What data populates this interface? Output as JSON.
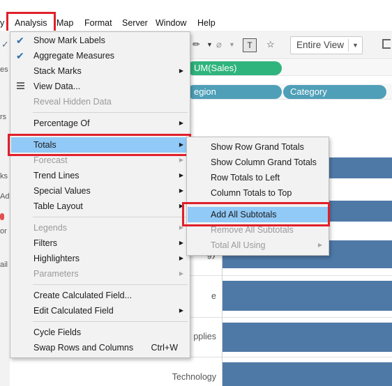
{
  "menubar": {
    "partial_left": "y",
    "items": [
      "Analysis",
      "Map",
      "Format",
      "Server",
      "Window",
      "Help"
    ]
  },
  "toolbar": {
    "fit_label": "Entire View"
  },
  "shelves": {
    "sum_sales_pill": "UM(Sales)",
    "region_pill": "egion",
    "category_pill": "Category"
  },
  "left_pane_fragments": [
    "es",
    "rs",
    "ks",
    "Ad",
    "or",
    "ail"
  ],
  "view": {
    "row_labels": [
      "gy",
      "e",
      "pplies",
      "Technology"
    ]
  },
  "analysis_menu": {
    "items": [
      {
        "label": "Show Mark Labels",
        "checked": true
      },
      {
        "label": "Aggregate Measures",
        "checked": true
      },
      {
        "label": "Stack Marks",
        "submenu": true
      },
      {
        "label": "View Data...",
        "icon": "view-data-icon"
      },
      {
        "label": "Reveal Hidden Data",
        "disabled": true
      },
      {
        "label": "Percentage Of",
        "submenu": true
      },
      {
        "label": "Totals",
        "submenu": true,
        "highlighted": true
      },
      {
        "label": "Forecast",
        "submenu": true,
        "disabled": true
      },
      {
        "label": "Trend Lines",
        "submenu": true
      },
      {
        "label": "Special Values",
        "submenu": true
      },
      {
        "label": "Table Layout",
        "submenu": true
      },
      {
        "label": "Legends",
        "submenu": true,
        "disabled": true
      },
      {
        "label": "Filters",
        "submenu": true
      },
      {
        "label": "Highlighters",
        "submenu": true
      },
      {
        "label": "Parameters",
        "submenu": true,
        "disabled": true
      },
      {
        "label": "Create Calculated Field..."
      },
      {
        "label": "Edit Calculated Field",
        "submenu": true
      },
      {
        "label": "Cycle Fields"
      },
      {
        "label": "Swap Rows and Columns",
        "shortcut": "Ctrl+W"
      }
    ]
  },
  "totals_submenu": {
    "items": [
      {
        "label": "Show Row Grand Totals"
      },
      {
        "label": "Show Column Grand Totals"
      },
      {
        "label": "Row Totals to Left"
      },
      {
        "label": "Column Totals to Top"
      },
      {
        "label": "Add All Subtotals",
        "highlighted": true
      },
      {
        "label": "Remove All Subtotals",
        "disabled": true
      },
      {
        "label": "Total All Using",
        "submenu": true,
        "disabled": true
      }
    ]
  },
  "colors": {
    "highlight": "#91c9f7",
    "annotation_red": "#e0202a",
    "bar_blue": "#4e79a7",
    "green_pill": "#2fb47d",
    "teal_pill": "#4f9fb8"
  }
}
